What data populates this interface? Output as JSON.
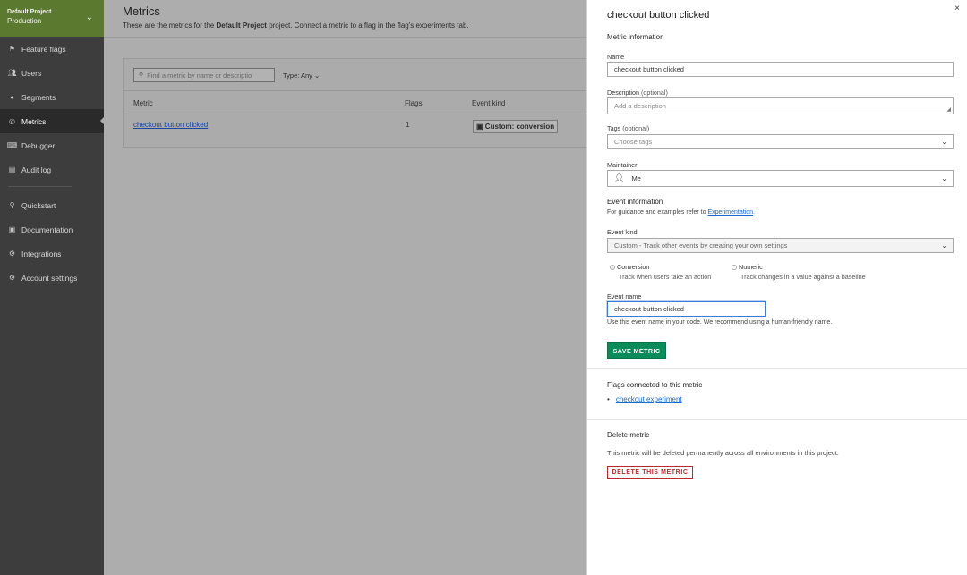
{
  "sidebar": {
    "project_name": "Default Project",
    "environment": "Production",
    "items": [
      {
        "label": "Feature flags",
        "icon": "flag-icon"
      },
      {
        "label": "Users",
        "icon": "users-icon"
      },
      {
        "label": "Segments",
        "icon": "segments-icon"
      },
      {
        "label": "Metrics",
        "icon": "metrics-icon",
        "active": true
      },
      {
        "label": "Debugger",
        "icon": "debugger-icon"
      },
      {
        "label": "Audit log",
        "icon": "audit-log-icon"
      }
    ],
    "secondary_items": [
      {
        "label": "Quickstart",
        "icon": "quickstart-icon"
      },
      {
        "label": "Documentation",
        "icon": "documentation-icon"
      },
      {
        "label": "Integrations",
        "icon": "integrations-icon"
      },
      {
        "label": "Account settings",
        "icon": "gear-icon"
      }
    ]
  },
  "main": {
    "title": "Metrics",
    "subtitle_pre": "These are the metrics for the ",
    "subtitle_project": "Default Project",
    "subtitle_post": " project. Connect a metric to a flag in the flag's experiments tab.",
    "search_placeholder": "Find a metric by name or descriptio",
    "type_filter": "Type: Any",
    "columns": [
      "Metric",
      "Flags",
      "Event kind"
    ],
    "rows": [
      {
        "metric": "checkout button clicked",
        "flags": "1",
        "event_kind": "Custom: conversion"
      }
    ]
  },
  "panel": {
    "title": "checkout button clicked",
    "metric_info_heading": "Metric information",
    "name_label": "Name",
    "name_value": "checkout button clicked",
    "description_label": "Description",
    "optional": "(optional)",
    "description_placeholder": "Add a description",
    "tags_label": "Tags",
    "tags_placeholder": "Choose tags",
    "maintainer_label": "Maintainer",
    "maintainer_value": "Me",
    "event_info_heading": "Event information",
    "guidance_text": "For guidance and examples refer to ",
    "guidance_link": "Experimentation",
    "guidance_end": ".",
    "event_kind_label": "Event kind",
    "event_kind_value": "Custom - Track other events by creating your own settings",
    "radio_conversion_label": "Conversion",
    "radio_conversion_desc": "Track when users take an action",
    "radio_numeric_label": "Numeric",
    "radio_numeric_desc": "Track changes in a value against a baseline",
    "event_name_label": "Event name",
    "event_name_value": "checkout button clicked",
    "event_name_help": "Use this event name in your code. We recommend using a human-friendly name.",
    "save_label": "SAVE METRIC",
    "flags_heading": "Flags connected to this metric",
    "flag_link": "checkout experiment",
    "delete_heading": "Delete metric",
    "delete_text": "This metric will be deleted permanently across all environments in this project.",
    "delete_label": "DELETE THIS METRIC",
    "close_glyph": "×"
  },
  "colors": {
    "project_header": "#5b7a2f",
    "save_button": "#0a8c5a",
    "danger": "#c0272d",
    "link": "#1a6ad0"
  }
}
